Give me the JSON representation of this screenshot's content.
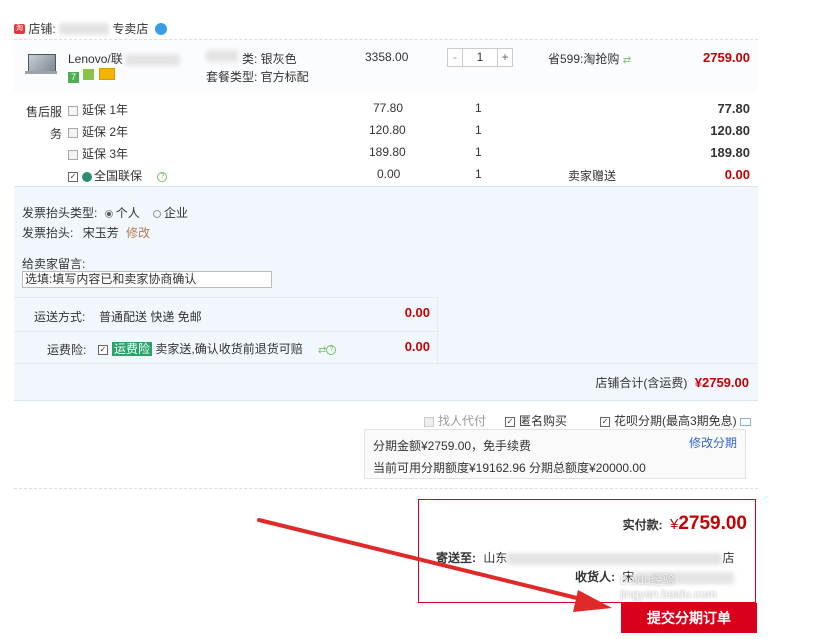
{
  "shop": {
    "label": "店铺:",
    "name_suffix": "专卖店"
  },
  "product": {
    "name_prefix": "Lenovo/联",
    "color_label": "类: ",
    "color_value": "银灰色",
    "package_label": "套餐类型: ",
    "package_value": "官方标配",
    "unit_price": "3358.00",
    "quantity": "1",
    "discount": "省599:淘抢购",
    "subtotal": "2759.00"
  },
  "after_sales": {
    "label": "售后服务",
    "items": [
      {
        "name": "延保 1年",
        "price": "77.80",
        "qty": "1",
        "total": "77.80",
        "note": "",
        "checked": false
      },
      {
        "name": "延保 2年",
        "price": "120.80",
        "qty": "1",
        "total": "120.80",
        "note": "",
        "checked": false
      },
      {
        "name": "延保 3年",
        "price": "189.80",
        "qty": "1",
        "total": "189.80",
        "note": "",
        "checked": false
      },
      {
        "name": "全国联保",
        "price": "0.00",
        "qty": "1",
        "total": "0.00",
        "note": "卖家赠送",
        "checked": true
      }
    ]
  },
  "invoice": {
    "type_label": "发票抬头类型:",
    "option_personal": "个人",
    "option_company": "企业",
    "title_label": "发票抬头:",
    "title_value": "宋玉芳",
    "modify": "修改"
  },
  "message": {
    "label": "给卖家留言:",
    "placeholder": "选填:填写内容已和卖家协商确认"
  },
  "shipping": {
    "label": "运送方式:",
    "value": "普通配送 快递 免邮",
    "fee": "0.00"
  },
  "insurance": {
    "label": "运费险:",
    "badge": "运费险",
    "desc": "卖家送,确认收货前退货可赔",
    "fee": "0.00"
  },
  "shop_total": {
    "label": "店铺合计(含运费)",
    "value": "¥2759.00"
  },
  "options": {
    "proxy": "找人代付",
    "anonymous": "匿名购买",
    "huabei": "花呗分期(最高3期免息)"
  },
  "installment": {
    "line1": "分期金额¥2759.00，免手续费",
    "modify": "修改分期",
    "line2": "当前可用分期额度¥19162.96 分期总额度¥20000.00"
  },
  "summary": {
    "paid_label": "实付款:",
    "currency": "¥",
    "paid_value": "2759.00",
    "ship_to_label": "寄送至:",
    "ship_to_prefix": "山东",
    "ship_to_suffix": "店",
    "receiver_label": "收货人:",
    "receiver_prefix": "宋",
    "submit": "提交分期订单"
  },
  "watermark": "Baidu经验 jingyan.baidu.com",
  "colors": {
    "price_red": "#c40000",
    "panel_blue": "#f2f7fd",
    "badge_green": "#2aa36a",
    "submit_red": "#d9001b",
    "arrow_red": "#e02a2a"
  }
}
